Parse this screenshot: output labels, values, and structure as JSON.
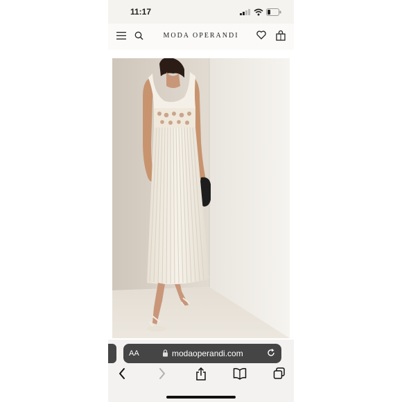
{
  "status_bar": {
    "time": "11:17"
  },
  "site_header": {
    "brand_name": "MODA OPERANDI",
    "icons": [
      "menu-icon",
      "search-icon",
      "heart-icon",
      "shopping-bag-icon"
    ]
  },
  "product_image": {
    "subject": "woman wearing white sleeveless crochet-cutout pleated midi dress with strappy sandals and black clutch"
  },
  "safari": {
    "text_size_label": "AA",
    "url": "modaoperandi.com",
    "icons": [
      "back-icon",
      "forward-icon",
      "share-icon",
      "bookmarks-icon",
      "tabs-icon"
    ]
  },
  "colors": {
    "page_bg": "#f5f3ef",
    "address_pill": "#454545",
    "dress": "#f3efe6"
  }
}
